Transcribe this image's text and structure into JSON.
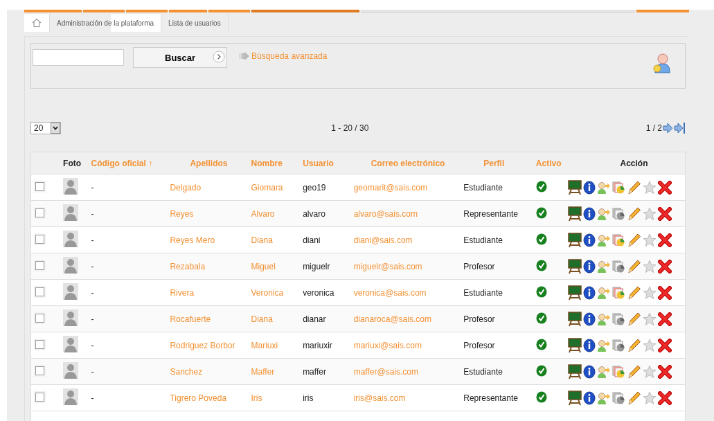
{
  "menu_tabs": [
    {
      "selected": false
    },
    {
      "selected": false
    },
    {
      "selected": false
    },
    {
      "selected": false
    },
    {
      "selected": false
    },
    {
      "selected": true
    },
    {
      "selected": false
    }
  ],
  "breadcrumb": [
    {
      "label": "Administración de la plataforma"
    },
    {
      "label": "Lista de usuarios"
    }
  ],
  "search": {
    "button": "Buscar",
    "advanced_link": "Búsqueda avanzada"
  },
  "pager": {
    "page_size": "20",
    "range": "1 - 20 / 30",
    "page": "1 / 2"
  },
  "table": {
    "columns": [
      {
        "label": "Foto",
        "sortable": false
      },
      {
        "label": "Código oficial ↑",
        "sortable": true
      },
      {
        "label": "Apellidos",
        "sortable": true
      },
      {
        "label": "Nombre",
        "sortable": true
      },
      {
        "label": "Usuario",
        "sortable": true
      },
      {
        "label": "Correo electrónico",
        "sortable": true
      },
      {
        "label": "Perfil",
        "sortable": true
      },
      {
        "label": "Activo",
        "sortable": true
      },
      {
        "label": "Acción",
        "sortable": false
      }
    ],
    "rows": [
      {
        "checked": false,
        "code": "-",
        "last_name": "Delgado",
        "first_name": "Giomara",
        "user": "geo19",
        "email": "geomarit@sais.com",
        "profile": "Estudiante",
        "active": true,
        "report_enabled": true
      },
      {
        "checked": false,
        "code": "-",
        "last_name": "Reyes",
        "first_name": "Alvaro",
        "user": "alvaro",
        "email": "alvaro@sais.com",
        "profile": "Representante",
        "active": true,
        "report_enabled": false
      },
      {
        "checked": false,
        "code": "-",
        "last_name": "Reyes Mero",
        "first_name": "Diana",
        "user": "diani",
        "email": "diani@sais.com",
        "profile": "Estudiante",
        "active": true,
        "report_enabled": true
      },
      {
        "checked": false,
        "code": "-",
        "last_name": "Rezabala",
        "first_name": "Miguel",
        "user": "miguelr",
        "email": "miguelr@sais.com",
        "profile": "Profesor",
        "active": true,
        "report_enabled": false
      },
      {
        "checked": false,
        "code": "-",
        "last_name": "Rivera",
        "first_name": "Veronica",
        "user": "veronica",
        "email": "veronica@sais.com",
        "profile": "Estudiante",
        "active": true,
        "report_enabled": true
      },
      {
        "checked": false,
        "code": "-",
        "last_name": "Rocafuerte",
        "first_name": "Diana",
        "user": "dianar",
        "email": "dianaroca@sais.com",
        "profile": "Profesor",
        "active": true,
        "report_enabled": false
      },
      {
        "checked": false,
        "code": "-",
        "last_name": "Rodriguez Borbor",
        "first_name": "Mariuxi",
        "user": "mariuxir",
        "email": "mariuxi@sais.com",
        "profile": "Profesor",
        "active": true,
        "report_enabled": false
      },
      {
        "checked": false,
        "code": "-",
        "last_name": "Sanchez",
        "first_name": "Maffer",
        "user": "maffer",
        "email": "maffer@sais.com",
        "profile": "Estudiante",
        "active": true,
        "report_enabled": true
      },
      {
        "checked": false,
        "code": "-",
        "last_name": "Tigrero Poveda",
        "first_name": "Iris",
        "user": "iris",
        "email": "iris@sais.com",
        "profile": "Representante",
        "active": true,
        "report_enabled": false
      }
    ]
  }
}
